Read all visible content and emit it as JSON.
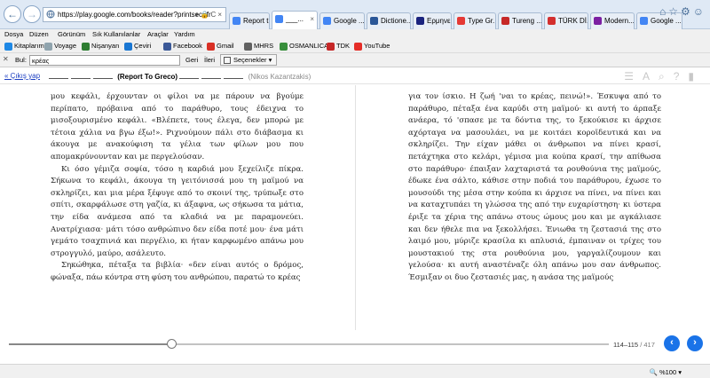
{
  "browser": {
    "url": "https://play.google.com/books/reader?printsec=fr",
    "tabs": [
      {
        "label": "Report t...",
        "favicon_color": "#4285f4"
      },
      {
        "label": "___...",
        "favicon_color": "#4285f4",
        "active": true
      },
      {
        "label": "Google ...",
        "favicon_color": "#4285f4"
      },
      {
        "label": "Dictione...",
        "favicon_color": "#2b5797"
      },
      {
        "label": "Ερμηνευ...",
        "favicon_color": "#1a237e"
      },
      {
        "label": "Type Gr...",
        "favicon_color": "#e53935"
      },
      {
        "label": "Tureng ...",
        "favicon_color": "#c62828"
      },
      {
        "label": "TÜRK Dİ...",
        "favicon_color": "#d32f2f"
      },
      {
        "label": "Modern...",
        "favicon_color": "#7b1fa2"
      },
      {
        "label": "Google ...",
        "favicon_color": "#4285f4"
      }
    ]
  },
  "menu": [
    "Dosya",
    "Düzen",
    "Görünüm",
    "Sık Kullanılanlar",
    "Araçlar",
    "Yardım"
  ],
  "favorites": [
    {
      "label": "Kitaplarım",
      "icon": "play-books-icon",
      "color": "#1e88e5"
    },
    {
      "label": "Voyage",
      "icon": "voyage-icon",
      "color": "#90a4ae"
    },
    {
      "label": "Nişanyan",
      "icon": "nisanyan-icon",
      "color": "#2e7d32"
    },
    {
      "label": "Çeviri",
      "icon": "translate-icon",
      "color": "#1976d2"
    },
    {
      "label": "Facebook",
      "icon": "facebook-icon",
      "color": "#3b5998"
    },
    {
      "label": "Gmail",
      "icon": "gmail-icon",
      "color": "#d93025"
    },
    {
      "label": "MHRS",
      "icon": "mhrs-icon",
      "color": "#616161"
    },
    {
      "label": "OSMANLICA",
      "icon": "osmanlica-icon",
      "color": "#388e3c"
    },
    {
      "label": "TDK",
      "icon": "tdk-icon",
      "color": "#c62828"
    },
    {
      "label": "YouTube",
      "icon": "youtube-icon",
      "color": "#e52d27"
    }
  ],
  "find": {
    "label": "Bul:",
    "query": "κρέας",
    "prev": "Geri",
    "next": "İleri",
    "options": "Seçenekler"
  },
  "reader": {
    "exit": "« Çıkış yap",
    "title": "(Report To Greco)",
    "author": "(Nikos Kazantzakis)",
    "left_page": [
      "μου κεφάλι, έρχουνταν οι φίλοι να με πάρουν να βγούμε περίπατο, πρόβαινα από το παράθυρο, τους έδειχνα το μισοξουρισμένο κεφάλι. «Βλέπετε, τους έλεγα, δεν μπορώ με τέτοια χάλια να βγω έξω!». Ριχνούμουν πάλι στο διάβασμα κι άκουγα με ανακούφιση τα γέλια των φίλων μου που απομακρύνουνταν και με περγελούσαν.",
      "Κι όσο γέμιζα σοφία, τόσο η καρδιά μου ξεχείλιζε πίκρα. Σήκωνα το κεφάλι, άκουγα τη γειτόνισσά μου τη μαϊμού να σκληρίζει, και μια μέρα ξέφυγε από το σκοινί της, τρύπωξε στο σπίτι, σκαρφάλωσε στη γαζία, κι άξαφνα, ως σήκωσα τα μάτια, την είδα ανάμεσα από τα κλαδιά να με παραμονεύει. Ανατρίχιασα· μάτι τόσο ανθρώπινο δεν είδα ποτέ μου· ένα μάτι γεμάτο τσαχπινιά και περγέλιο, κι ήταν καρφωμένο απάνω μου στρογγυλό, μαύρο, ασάλευτο.",
      "Σηκώθηκα, πέταξα τα βιβλία· «δεν είναι αυτός ο δρόμος, φώναξα, πάω κόντρα στη φύση του ανθρώπου, παρατώ το κρέας"
    ],
    "right_page": [
      "για τον ίσκιο. Η ζωή 'ναι το κρέας, πεινώ!». Έσκυψα από το παράθυρο, πέταξα ένα καρύδι στη μαϊμού· κι αυτή το άρπαξε ανάερα, τό 'σπασε με τα δόντια της, το ξεκούκισε κι άρχισε αχόρταγα να μασουλάει, να με κοιτάει κοροϊδευτικά και να σκληρίζει. Την είχαν μάθει οι άνθρωποι να πίνει κρασί, πετάχτηκα στο κελάρι, γέμισα μια κούπα κρασί, την απίθωσα στο παράθυρο· έπαιξαν λαχταριστά τα ρουθούνια της μαϊμούς, έδωκε ένα σάλτο, κάθισε στην ποδιά του παράθυρου, έχωσε το μουσούδι της μέσα στην κούπα κι άρχισε να πίνει, να πίνει και να καταχτυπάει τη γλώσσα της από την ευχαρίστηση· κι ύστερα έριξε τα χέρια της απάνω στους ώμους μου και με αγκάλιασε και δεν ήθελε πια να ξεκολλήσει. Ένιωθα τη ζεστασιά της στο λαιμό μου, μύριζε κρασίλα κι απλυσιά, έμπαιναν οι τρίχες του μουστακιού της στα ρουθούνια μου, γαργαλίζουμουν και γελούσα· κι αυτή αναστέναζε όλη απάνω μου σαν άνθρωπος. Έσμιξαν οι δυο ζεστασιές μας, η ανάσα της μαϊμούς"
    ],
    "pages_current": "114–115",
    "pages_total": "/ 417",
    "progress_fraction": 0.27
  },
  "status": {
    "zoom": "%100"
  }
}
